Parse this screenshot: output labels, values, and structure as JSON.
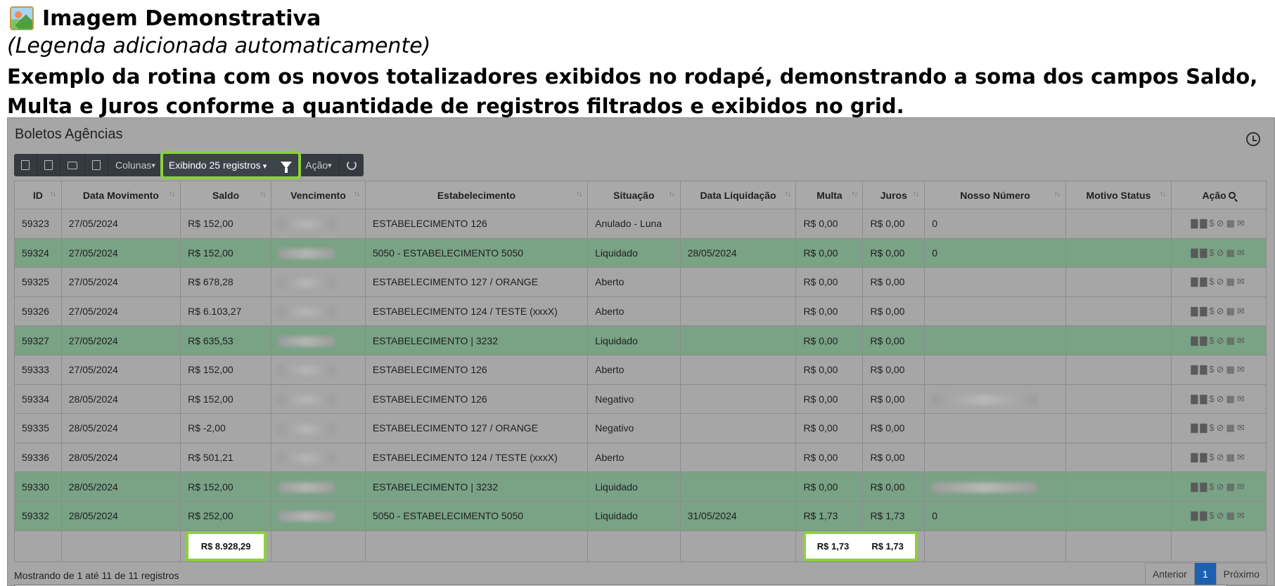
{
  "caption": {
    "title": "Imagem Demonstrativa",
    "subtitle": "(Legenda adicionada automaticamente)",
    "description": "Exemplo da rotina com os novos totalizadores exibidos no rodapé, demonstrando a soma dos campos Saldo, Multa e Juros conforme a quantidade de registros filtrados e exibidos no grid."
  },
  "panel": {
    "title": "Boletos Agências"
  },
  "toolbar": {
    "colunas_label": "Colunas",
    "exibindo_label": "Exibindo 25 registros",
    "acao_label": "Ação"
  },
  "grid": {
    "headers": {
      "id": "ID",
      "data_movimento": "Data Movimento",
      "saldo": "Saldo",
      "vencimento": "Vencimento",
      "estabelecimento": "Estabelecimento",
      "situacao": "Situação",
      "data_liquidacao": "Data Liquidação",
      "multa": "Multa",
      "juros": "Juros",
      "nosso_numero": "Nosso Número",
      "motivo_status": "Motivo Status",
      "acao": "Ação"
    },
    "rows": [
      {
        "id": "59323",
        "data_movimento": "27/05/2024",
        "saldo": "R$ 152,00",
        "estabelecimento": "ESTABELECIMENTO 126",
        "situacao": "Anulado - Luna",
        "data_liquidacao": "",
        "multa": "R$ 0,00",
        "juros": "R$ 0,00",
        "nosso_numero": "0",
        "nosso_blurred": false,
        "highlight": false
      },
      {
        "id": "59324",
        "data_movimento": "27/05/2024",
        "saldo": "R$ 152,00",
        "estabelecimento": "5050 - ESTABELECIMENTO 5050",
        "situacao": "Liquidado",
        "data_liquidacao": "28/05/2024",
        "multa": "R$ 0,00",
        "juros": "R$ 0,00",
        "nosso_numero": "0",
        "nosso_blurred": false,
        "highlight": true
      },
      {
        "id": "59325",
        "data_movimento": "27/05/2024",
        "saldo": "R$ 678,28",
        "estabelecimento": "ESTABELECIMENTO 127 / ORANGE",
        "situacao": "Aberto",
        "data_liquidacao": "",
        "multa": "R$ 0,00",
        "juros": "R$ 0,00",
        "nosso_numero": "",
        "nosso_blurred": false,
        "highlight": false
      },
      {
        "id": "59326",
        "data_movimento": "27/05/2024",
        "saldo": "R$ 6.103,27",
        "estabelecimento": "ESTABELECIMENTO 124 / TESTE (xxxX)",
        "situacao": "Aberto",
        "data_liquidacao": "",
        "multa": "R$ 0,00",
        "juros": "R$ 0,00",
        "nosso_numero": "",
        "nosso_blurred": false,
        "highlight": false
      },
      {
        "id": "59327",
        "data_movimento": "27/05/2024",
        "saldo": "R$ 635,53",
        "estabelecimento": "ESTABELECIMENTO | 3232",
        "situacao": "Liquidado",
        "data_liquidacao": "",
        "multa": "R$ 0,00",
        "juros": "R$ 0,00",
        "nosso_numero": "",
        "nosso_blurred": false,
        "highlight": true
      },
      {
        "id": "59333",
        "data_movimento": "27/05/2024",
        "saldo": "R$ 152,00",
        "estabelecimento": "ESTABELECIMENTO 126",
        "situacao": "Aberto",
        "data_liquidacao": "",
        "multa": "R$ 0,00",
        "juros": "R$ 0,00",
        "nosso_numero": "",
        "nosso_blurred": false,
        "highlight": false
      },
      {
        "id": "59334",
        "data_movimento": "28/05/2024",
        "saldo": "R$ 152,00",
        "estabelecimento": "ESTABELECIMENTO 126",
        "situacao": "Negativo",
        "data_liquidacao": "",
        "multa": "R$ 0,00",
        "juros": "R$ 0,00",
        "nosso_numero": "",
        "nosso_blurred": true,
        "highlight": false
      },
      {
        "id": "59335",
        "data_movimento": "28/05/2024",
        "saldo": "R$ -2,00",
        "estabelecimento": "ESTABELECIMENTO 127 / ORANGE",
        "situacao": "Negativo",
        "data_liquidacao": "",
        "multa": "R$ 0,00",
        "juros": "R$ 0,00",
        "nosso_numero": "",
        "nosso_blurred": false,
        "highlight": false
      },
      {
        "id": "59336",
        "data_movimento": "28/05/2024",
        "saldo": "R$ 501,21",
        "estabelecimento": "ESTABELECIMENTO 124 / TESTE (xxxX)",
        "situacao": "Aberto",
        "data_liquidacao": "",
        "multa": "R$ 0,00",
        "juros": "R$ 0,00",
        "nosso_numero": "",
        "nosso_blurred": false,
        "highlight": false
      },
      {
        "id": "59330",
        "data_movimento": "28/05/2024",
        "saldo": "R$ 152,00",
        "estabelecimento": "ESTABELECIMENTO | 3232",
        "situacao": "Liquidado",
        "data_liquidacao": "",
        "multa": "R$ 0,00",
        "juros": "R$ 0,00",
        "nosso_numero": "",
        "nosso_blurred": true,
        "highlight": true
      },
      {
        "id": "59332",
        "data_movimento": "28/05/2024",
        "saldo": "R$ 252,00",
        "estabelecimento": "5050 - ESTABELECIMENTO 5050",
        "situacao": "Liquidado",
        "data_liquidacao": "31/05/2024",
        "multa": "R$ 1,73",
        "juros": "R$ 1,73",
        "nosso_numero": "0",
        "nosso_blurred": false,
        "highlight": true
      }
    ],
    "totals": {
      "saldo": "R$ 8.928,29",
      "multa": "R$ 1,73",
      "juros": "R$ 1,73"
    }
  },
  "footer": {
    "info": "Mostrando de 1 até 11 de 11 registros",
    "prev": "Anterior",
    "page": "1",
    "next": "Próximo"
  },
  "colors": {
    "highlight_green": "#8bd13c",
    "row_green": "#7aa285",
    "toolbar_bg": "#343a40",
    "pager_active": "#1d5fb0"
  }
}
